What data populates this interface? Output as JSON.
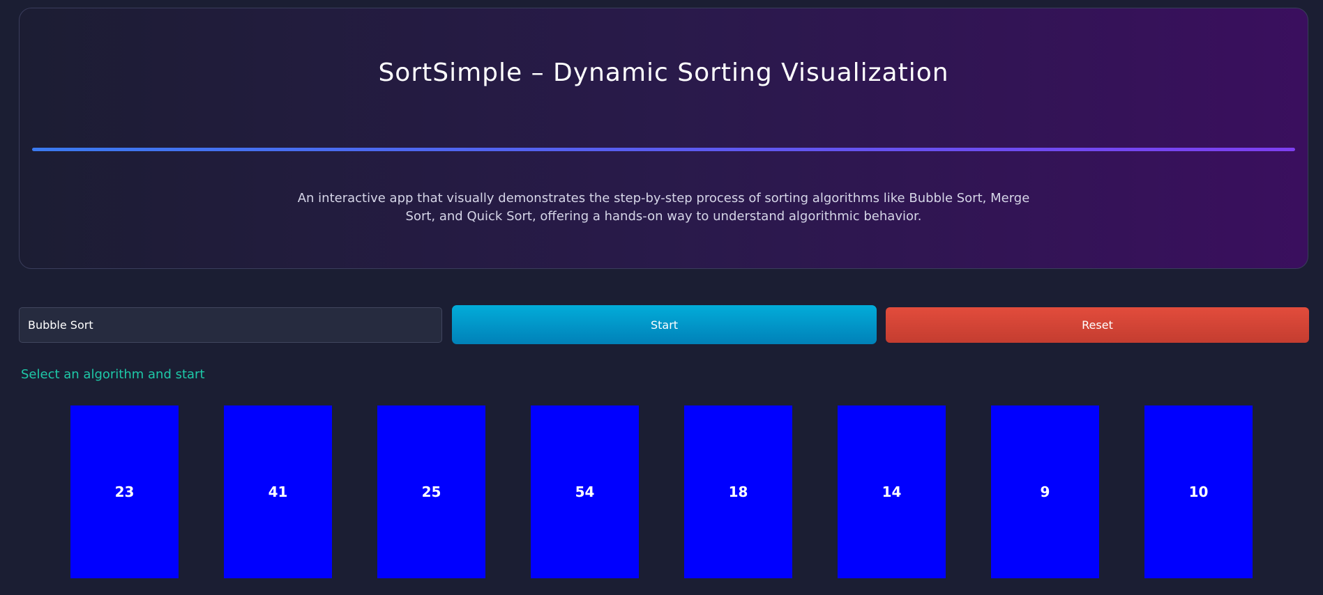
{
  "header": {
    "title": "SortSimple – Dynamic Sorting Visualization",
    "description": "An interactive app that visually demonstrates the step-by-step process of sorting algorithms like Bubble Sort, Merge Sort, and Quick Sort, offering a hands-on way to understand algorithmic behavior."
  },
  "controls": {
    "algorithm_value": "Bubble Sort",
    "start_label": "Start",
    "reset_label": "Reset"
  },
  "status": {
    "message": "Select an algorithm and start"
  },
  "array": {
    "values": [
      "23",
      "41",
      "25",
      "54",
      "18",
      "14",
      "9",
      "10"
    ]
  },
  "colors": {
    "bar": "#0000ff",
    "start_button": "#02acd9",
    "reset_button": "#e24c3c",
    "status_text": "#1ec9a8",
    "accent_gradient_start": "#3b7af0",
    "accent_gradient_end": "#7e3ff0"
  }
}
